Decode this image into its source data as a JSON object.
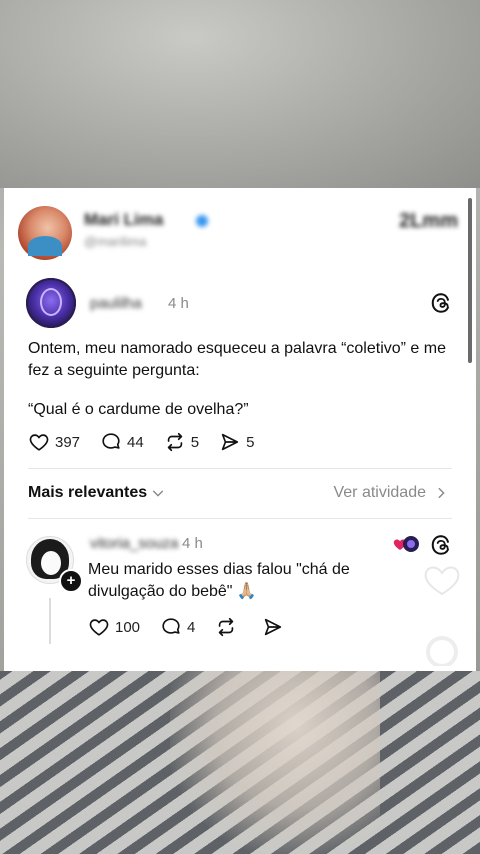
{
  "header": {
    "name": "Mari Lima",
    "handle": "@marilima",
    "stat": "2Lmm"
  },
  "post": {
    "username": "paulilha",
    "time": "4 h",
    "text": "Ontem, meu namorado esqueceu a palavra “coletivo” e me fez a seguinte pergunta:",
    "quote": "“Qual é o cardume de ovelha?”",
    "likes": "397",
    "comments": "44",
    "reposts": "5",
    "shares": "5"
  },
  "sort": {
    "label": "Mais relevantes",
    "activity_link": "Ver atividade"
  },
  "reply": {
    "username": "vitoria_souza",
    "time": "4 h",
    "text": "Meu marido esses dias falou \"chá de divulgação do bebê\" 🙏🏼",
    "likes": "100",
    "comments": "4"
  },
  "icons": {
    "like": "heart-icon",
    "comment": "comment-bubble-icon",
    "repost": "repost-icon",
    "share": "send-icon",
    "app": "threads-logo-icon"
  }
}
